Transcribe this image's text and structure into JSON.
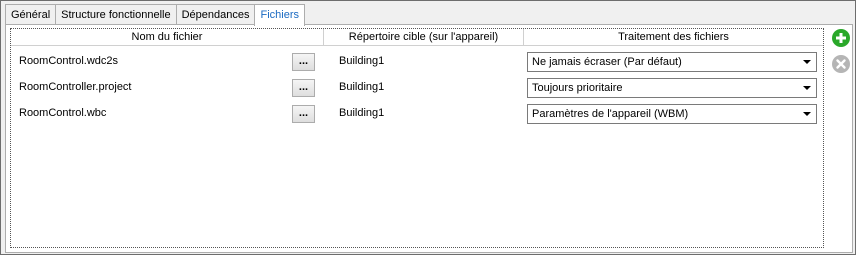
{
  "tabs": [
    {
      "label": "Général",
      "active": false
    },
    {
      "label": "Structure fonctionnelle",
      "active": false
    },
    {
      "label": "Dépendances",
      "active": false
    },
    {
      "label": "Fichiers",
      "active": true
    }
  ],
  "grid": {
    "columns": [
      "Nom du fichier",
      "Répertoire cible (sur l'appareil)",
      "Traitement des fichiers"
    ],
    "browse_label": "...",
    "rows": [
      {
        "filename": "RoomControl.wdc2s",
        "target": "Building1",
        "treatment": "Ne jamais écraser (Par défaut)"
      },
      {
        "filename": "RoomController.project",
        "target": "Building1",
        "treatment": "Toujours prioritaire"
      },
      {
        "filename": "RoomControl.wbc",
        "target": "Building1",
        "treatment": "Paramètres de l'appareil (WBM)"
      }
    ]
  },
  "side_buttons": {
    "add_icon": "plus-circle-icon",
    "remove_icon": "x-circle-icon",
    "add_color": "#2aa82a",
    "remove_color": "#b5b5b5"
  },
  "colors": {
    "active_tab_text": "#1a6ac2"
  }
}
